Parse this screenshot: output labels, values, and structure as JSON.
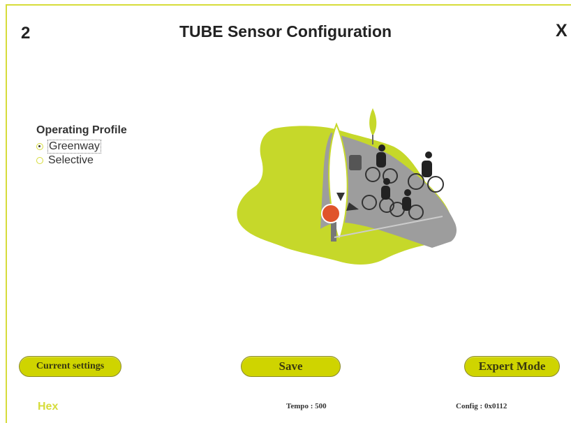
{
  "header": {
    "step": "2",
    "title": "TUBE Sensor Configuration",
    "close_label": "X"
  },
  "profile": {
    "heading": "Operating Profile",
    "options": [
      {
        "label": "Greenway",
        "selected": true
      },
      {
        "label": "Selective",
        "selected": false
      }
    ]
  },
  "illustration": {
    "description_icon": "cyclists-on-greenway-icon",
    "colors": {
      "grass": "#c6d82a",
      "road": "#9a9a9a",
      "sign_red": "#e0542a"
    }
  },
  "buttons": {
    "current_settings": "Current settings",
    "save": "Save",
    "expert_mode": "Expert Mode"
  },
  "footer": {
    "hex": "Hex",
    "tempo": "Tempo : 500",
    "config": "Config : 0x0112"
  },
  "colors": {
    "accent": "#d6dc3a",
    "button_fill": "#cfd400"
  }
}
